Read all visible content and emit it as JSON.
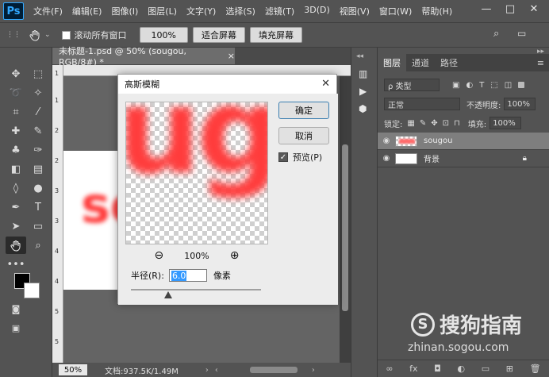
{
  "app": {
    "logo": "Ps"
  },
  "menu": [
    "文件(F)",
    "编辑(E)",
    "图像(I)",
    "图层(L)",
    "文字(Y)",
    "选择(S)",
    "滤镜(T)",
    "3D(D)",
    "视图(V)",
    "窗口(W)",
    "帮助(H)"
  ],
  "window_controls": {
    "minimize": "—",
    "restore": "□",
    "close": "✕"
  },
  "options_bar": {
    "tool_icon": "hand-icon",
    "scroll_all_label": "滚动所有窗口",
    "zoom_100": "100%",
    "fit_screen": "适合屏幕",
    "fill_screen": "填充屏幕"
  },
  "document": {
    "tab_title": "未标题-1.psd @ 50% (sougou, RGB/8#) *",
    "tab_close": "×",
    "canvas_text": "so",
    "ruler_left_labels": [
      "1",
      "1",
      "2",
      "2",
      "3",
      "3",
      "4",
      "4",
      "5",
      "5"
    ],
    "zoom": "50%",
    "doc_info": "文档:937.5K/1.49M"
  },
  "dialog": {
    "title": "高斯模糊",
    "close": "✕",
    "preview_text": "ug",
    "ok_label": "确定",
    "cancel_label": "取消",
    "preview_label": "预览(P)",
    "preview_checked": true,
    "zoom_out": "⊖",
    "zoom_level": "100%",
    "zoom_in": "⊕",
    "radius_label": "半径(R):",
    "radius_value": "6.0",
    "radius_unit": "像素"
  },
  "layers_panel": {
    "tabs": [
      "图层",
      "通道",
      "路径"
    ],
    "active_tab": 0,
    "filter_label": "ρ 类型",
    "blend_mode": "正常",
    "opacity_label": "不透明度:",
    "opacity_value": "100%",
    "lock_label": "锁定:",
    "fill_label": "填充:",
    "fill_value": "100%",
    "layers": [
      {
        "name": "sougou",
        "selected": true
      },
      {
        "name": "背景",
        "selected": false,
        "locked": true
      }
    ],
    "footer_icons": [
      "link-icon",
      "fx-icon",
      "mask-icon",
      "adjustment-icon",
      "folder-icon",
      "new-layer-icon",
      "trash-icon"
    ]
  },
  "watermark": {
    "main": "搜狗指南",
    "sub": "zhinan.sogou.com"
  },
  "colors": {
    "ui_dark": "#535353",
    "blur_red": "#ff3c3c",
    "dialog_bg": "#ececec"
  }
}
